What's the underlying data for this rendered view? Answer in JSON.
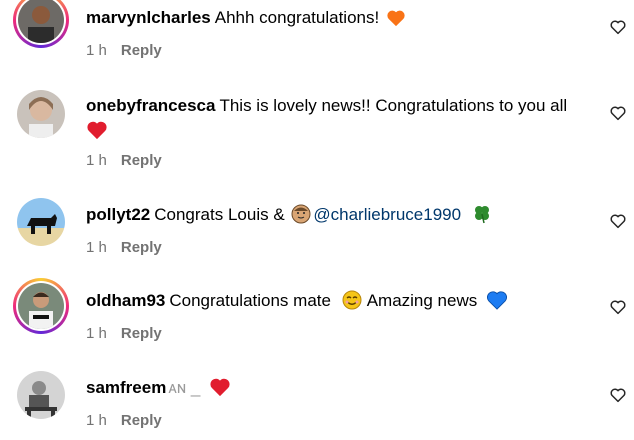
{
  "comments": [
    {
      "username": "marvynlcharles",
      "text": "Ahhh congratulations!",
      "time": "1 h",
      "reply": "Reply"
    },
    {
      "username": "onebyfrancesca",
      "text": "This is lovely news!! Congratulations to you all",
      "time": "1 h",
      "reply": "Reply"
    },
    {
      "username": "pollyt22",
      "text_before": "Congrats Louis &",
      "mention": "@charliebruce1990",
      "time": "1 h",
      "reply": "Reply"
    },
    {
      "username": "oldham93",
      "text_before": "Congratulations mate",
      "text_after": "Amazing news",
      "time": "1 h",
      "reply": "Reply"
    },
    {
      "username": "samfreem",
      "text": "ᴀɴ _",
      "time": "1 h",
      "reply": "Reply"
    }
  ],
  "icons": {
    "heart_orange": "#f97316",
    "heart_red": "#e11d2e",
    "heart_blue": "#1d7cf2",
    "clover": "#2e8b2e",
    "smile": "#f5c518"
  }
}
